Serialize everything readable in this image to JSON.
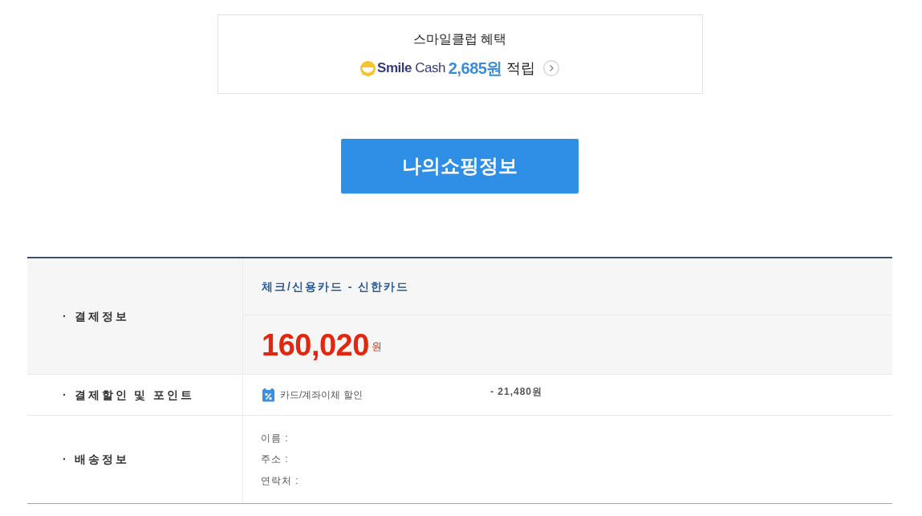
{
  "benefit_card": {
    "title": "스마일클럽 혜택",
    "logo_text": "**Smile** Cash",
    "amount": "2,685원",
    "suffix": "적립"
  },
  "primary_button": {
    "label": "나의쇼핑정보"
  },
  "info_table": {
    "rows": [
      {
        "kind": "payment",
        "label": "· 결제정보",
        "method": "체크/신용카드 - 신한카드",
        "amount": "160,020",
        "currency": "원"
      },
      {
        "kind": "discount",
        "label": "· 결제할인 및 포인트",
        "item": "카드/계좌이체 할인",
        "value": "- 21,480원"
      },
      {
        "kind": "shipping",
        "label": "· 배송정보",
        "fields": [
          "이름 :",
          "주소 :",
          "연락처 :"
        ]
      }
    ]
  }
}
